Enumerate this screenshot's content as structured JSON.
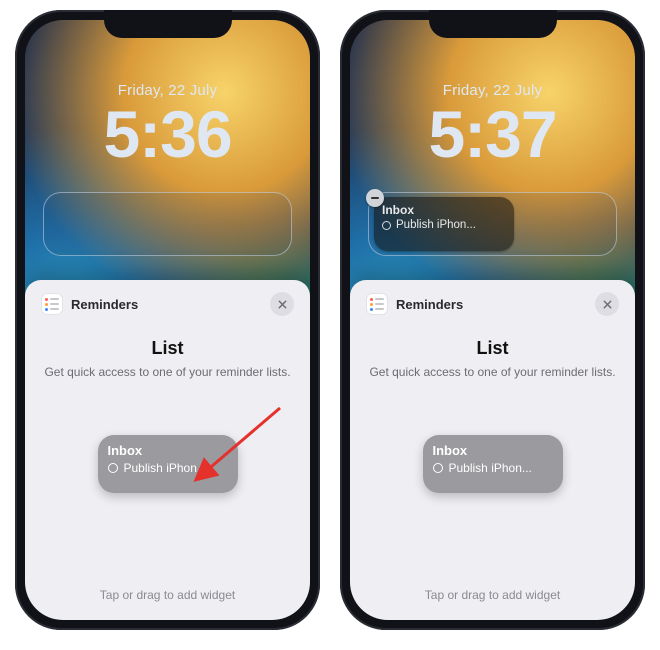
{
  "phones": [
    {
      "date": "Friday, 22 July",
      "time": "5:36",
      "slot_has_widget": false,
      "show_arrow": true,
      "sheet": {
        "app_name": "Reminders",
        "title": "List",
        "subtitle": "Get quick access to one of your reminder lists.",
        "widget": {
          "list_name": "Inbox",
          "item_preview": "Publish iPhon..."
        },
        "hint": "Tap or drag to add widget"
      }
    },
    {
      "date": "Friday, 22 July",
      "time": "5:37",
      "slot_has_widget": true,
      "slot_widget": {
        "list_name": "Inbox",
        "item_preview": "Publish iPhon..."
      },
      "show_arrow": false,
      "sheet": {
        "app_name": "Reminders",
        "title": "List",
        "subtitle": "Get quick access to one of your reminder lists.",
        "widget": {
          "list_name": "Inbox",
          "item_preview": "Publish iPhon..."
        },
        "hint": "Tap or drag to add widget"
      }
    }
  ],
  "colors": {
    "arrow": "#e4312b"
  }
}
